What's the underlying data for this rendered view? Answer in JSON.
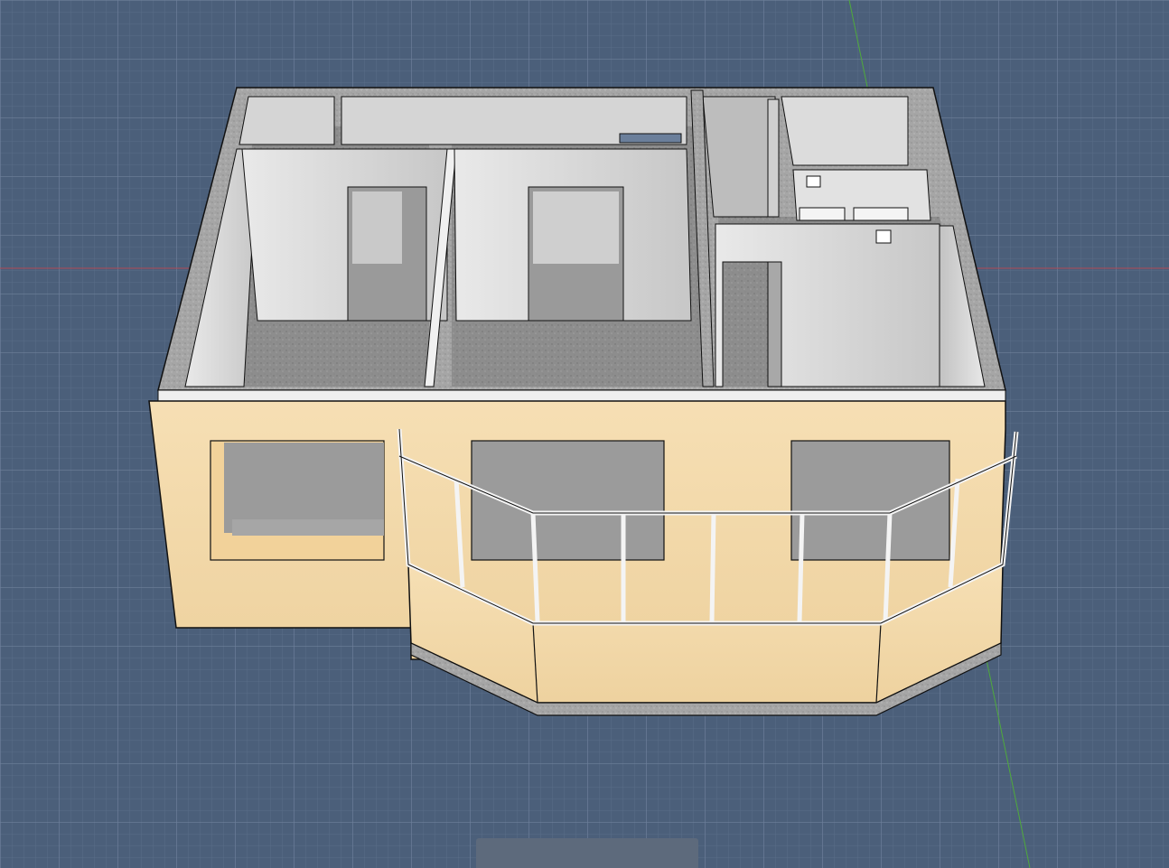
{
  "app": {
    "view": "3d-perspective",
    "scene": "apartment-floor-plan"
  },
  "colors": {
    "ground": "#4b5f7a",
    "grid_minor": "#5a6d88",
    "grid_major": "#6e809b",
    "axis_x": "#b04a55",
    "axis_y": "#4faa3c",
    "wall_top": "#a9a9a9",
    "wall_inner": "#d8d8d8",
    "facade": "#f3d9ab",
    "facade_shadow": "#e8cc98",
    "floor": "#8f8f8f",
    "frame": "#f2f2f2",
    "outline": "#111111",
    "bottom_tab": "#5d6a7c"
  },
  "bottom_panel": {
    "label": ""
  }
}
